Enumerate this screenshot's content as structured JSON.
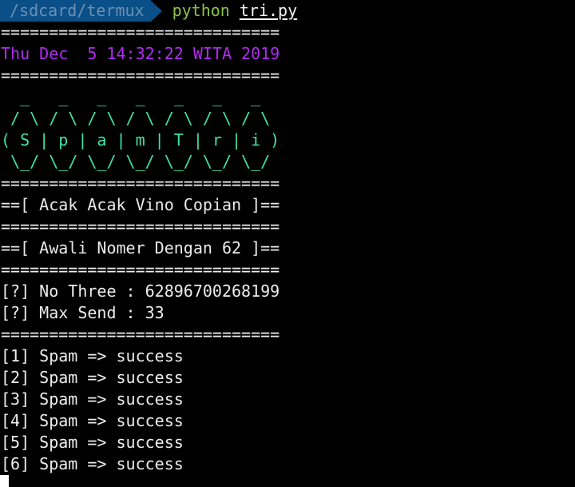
{
  "prompt": {
    "path": "/sdcard/termux",
    "command": "python",
    "argument": "tri.py"
  },
  "colors": {
    "path_bg": "#0b4f88",
    "command": "#8bc34a",
    "date": "#b12cf0",
    "banner": "#40e4a2"
  },
  "output": {
    "separator": "=============================",
    "date": "Thu Dec  5 14:32:22 WITA 2019",
    "banner": [
      "  _   _   _   _   _   _   _  ",
      " / \\ / \\ / \\ / \\ / \\ / \\ / \\ ",
      "( S | p | a | m | T | r | i )",
      " \\_/ \\_/ \\_/ \\_/ \\_/ \\_/ \\_/ "
    ],
    "title": "==[ Acak Acak Vino Copian ]==",
    "subtitle": "==[ Awali Nomer Dengan 62 ]==",
    "info": [
      "[?] No Three : 62896700268199",
      "[?] Max Send : 33"
    ],
    "results": [
      "[1] Spam => success",
      "[2] Spam => success",
      "[3] Spam => success",
      "[4] Spam => success",
      "[5] Spam => success",
      "[6] Spam => success"
    ]
  }
}
